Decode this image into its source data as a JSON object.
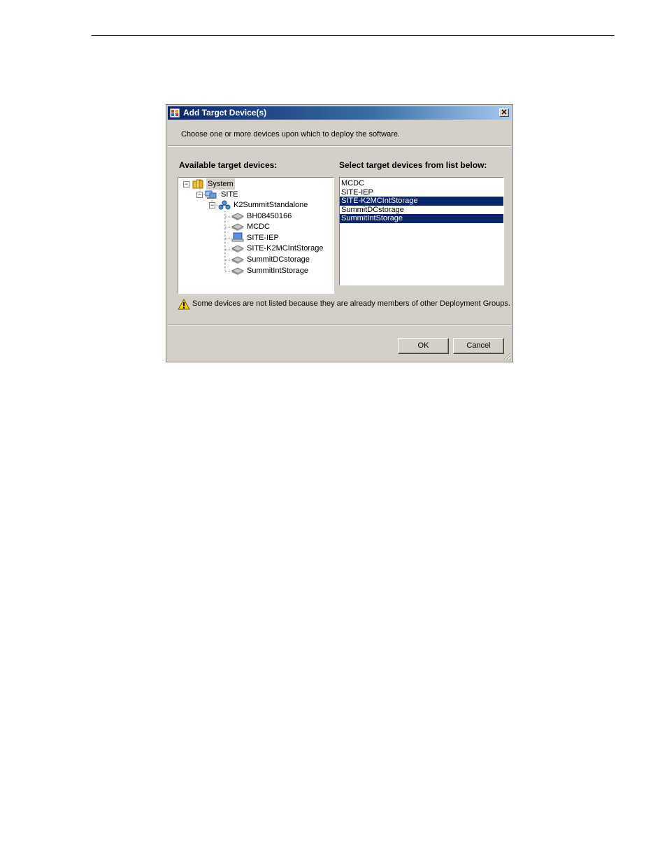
{
  "dialog": {
    "title": "Add Target Device(s)",
    "close_label": "✕",
    "instruction": "Choose one or more devices upon which to deploy the software."
  },
  "available": {
    "label": "Available target devices:",
    "tree": [
      {
        "label": "System",
        "icon": "folder-icon",
        "level": 0,
        "expanded": true
      },
      {
        "label": "SITE",
        "icon": "site-icon",
        "level": 1,
        "expanded": true
      },
      {
        "label": "K2SummitStandalone",
        "icon": "network-group-icon",
        "level": 2,
        "expanded": true
      },
      {
        "label": "BH08450166",
        "icon": "storage-device-icon",
        "level": 3
      },
      {
        "label": "MCDC",
        "icon": "storage-device-icon",
        "level": 3
      },
      {
        "label": "SITE-IEP",
        "icon": "computer-icon",
        "level": 3
      },
      {
        "label": "SITE-K2MCIntStorage",
        "icon": "storage-device-icon",
        "level": 3
      },
      {
        "label": "SummitDCstorage",
        "icon": "storage-device-icon",
        "level": 3
      },
      {
        "label": "SummitIntStorage",
        "icon": "storage-device-icon",
        "level": 3
      }
    ]
  },
  "selected": {
    "label": "Select target devices from list below:",
    "items": [
      {
        "label": "MCDC",
        "selected": false
      },
      {
        "label": "SITE-IEP",
        "selected": false
      },
      {
        "label": "SITE-K2MCIntStorage",
        "selected": true
      },
      {
        "label": "SummitDCstorage",
        "selected": false
      },
      {
        "label": "SummitIntStorage",
        "selected": true
      }
    ]
  },
  "warning": {
    "text": "Some devices are not listed because they are already members of other Deployment Groups."
  },
  "buttons": {
    "ok": "OK",
    "cancel": "Cancel"
  },
  "colors": {
    "selection": "#0a246a",
    "dialog_bg": "#d4d0c8"
  }
}
